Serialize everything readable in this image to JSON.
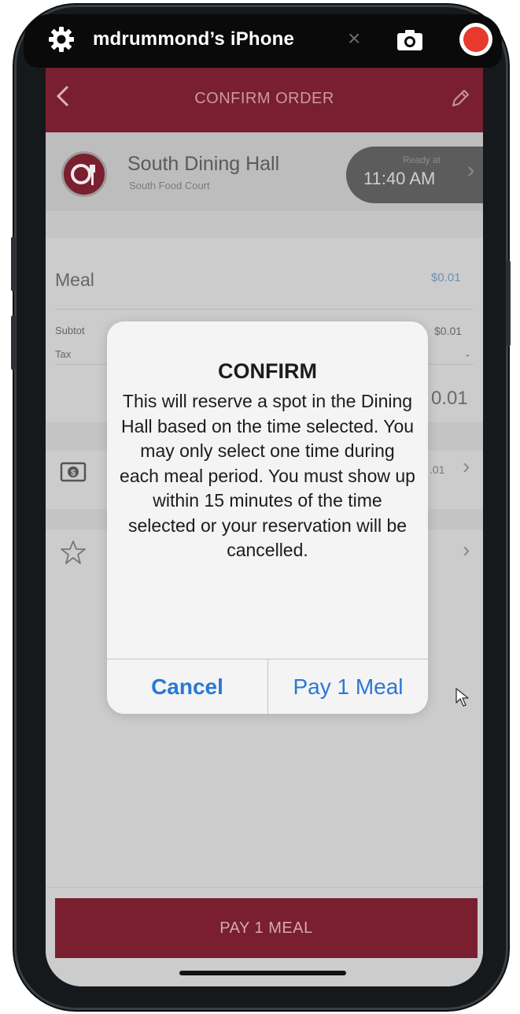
{
  "mirror_bar": {
    "device_name": "mdrummond’s iPhone",
    "close_glyph": "×",
    "icons": [
      "gear-icon",
      "camera-icon",
      "record-icon"
    ],
    "record_color": "#e7392d"
  },
  "navbar": {
    "title": "CONFIRM ORDER",
    "background": "#7a1f2f",
    "icons": [
      "back-chevron-icon",
      "pencil-icon"
    ]
  },
  "location": {
    "name": "South Dining Hall",
    "sub": "South Food Court",
    "ready_label": "Ready at",
    "ready_time": "11:40 AM",
    "icon": "utensils-logo-icon"
  },
  "order": {
    "items": [
      {
        "label": "Meal",
        "price": "$0.01"
      }
    ],
    "subtotal_label": "Subtot",
    "subtotal_value": "$0.01",
    "tax_label": "Tax",
    "tax_value": "-",
    "total_value": "0.01"
  },
  "payment": {
    "amount": ".01",
    "icon": "dollar-card-icon"
  },
  "favorite": {
    "icon": "star-icon"
  },
  "dialog": {
    "title": "CONFIRM",
    "message": "This will reserve a spot in the Dining Hall based on the time selected.  You may only select one time during each meal period.  You must show up within 15 minutes of the time selected or your reservation will be cancelled.",
    "cancel_label": "Cancel",
    "confirm_label": "Pay 1 Meal",
    "button_color": "#2a78d5"
  },
  "footer": {
    "pay_label": "PAY 1 MEAL"
  }
}
